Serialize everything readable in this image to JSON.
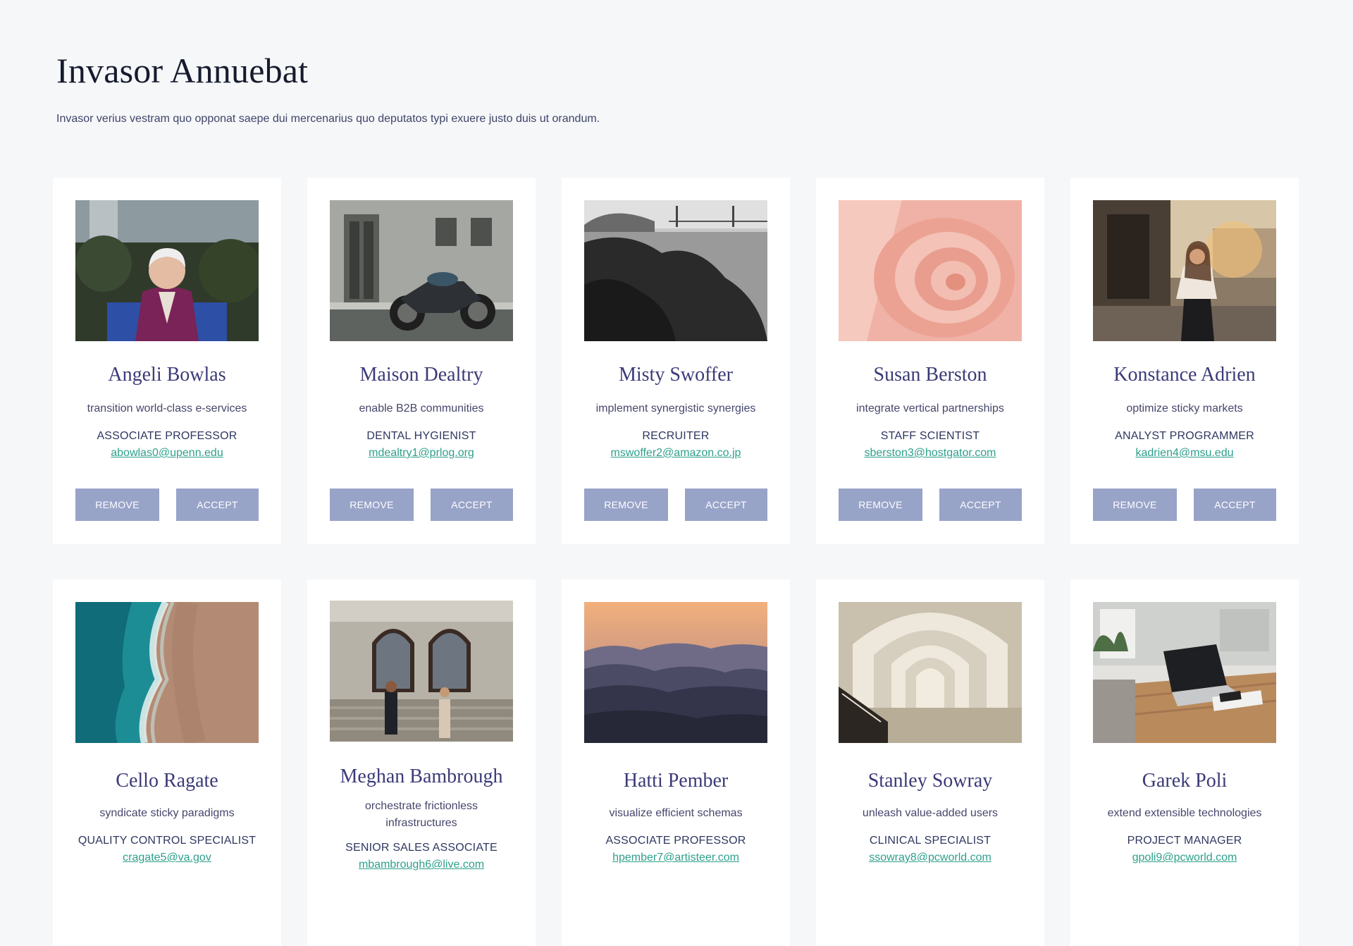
{
  "header": {
    "title": "Invasor Annuebat",
    "subtitle": "Invasor verius vestram quo opponat saepe dui mercenarius quo deputatos typi exuere justo duis ut orandum."
  },
  "colors": {
    "background": "#f6f7f9",
    "card": "#ffffff",
    "name": "#3b3a78",
    "email_link": "#2ea08b",
    "button": "#98a3c8"
  },
  "buttons": {
    "remove_label": "REMOVE",
    "accept_label": "ACCEPT"
  },
  "people": [
    {
      "name": "Angeli Bowlas",
      "tagline": "transition world-class e-services",
      "role": "ASSOCIATE PROFESSOR",
      "email": "abowlas0@upenn.edu",
      "image": "older-woman-portrait-photo"
    },
    {
      "name": "Maison Dealtry",
      "tagline": "enable B2B communities",
      "role": "DENTAL HYGIENIST",
      "email": "mdealtry1@prlog.org",
      "image": "motorcycle-street-photo"
    },
    {
      "name": "Misty Swoffer",
      "tagline": "implement synergistic synergies",
      "role": "RECRUITER",
      "email": "mswoffer2@amazon.co.jp",
      "image": "bay-bridge-bw-photo"
    },
    {
      "name": "Susan Berston",
      "tagline": "integrate vertical partnerships",
      "role": "STAFF SCIENTIST",
      "email": "sberston3@hostgator.com",
      "image": "pink-spiral-abstract-photo"
    },
    {
      "name": "Konstance Adrien",
      "tagline": "optimize sticky markets",
      "role": "ANALYST PROGRAMMER",
      "email": "kadrien4@msu.edu",
      "image": "woman-sunset-street-photo"
    },
    {
      "name": "Cello Ragate",
      "tagline": "syndicate sticky paradigms",
      "role": "QUALITY CONTROL SPECIALIST",
      "email": "cragate5@va.gov",
      "image": "aerial-beach-waves-photo"
    },
    {
      "name": "Meghan Bambrough",
      "tagline": "orchestrate frictionless infrastructures",
      "role": "SENIOR SALES ASSOCIATE",
      "email": "mbambrough6@live.com",
      "image": "couple-building-steps-photo"
    },
    {
      "name": "Hatti Pember",
      "tagline": "visualize efficient schemas",
      "role": "ASSOCIATE PROFESSOR",
      "email": "hpember7@artisteer.com",
      "image": "mountain-sunset-photo"
    },
    {
      "name": "Stanley Sowray",
      "tagline": "unleash value-added users",
      "role": "CLINICAL SPECIALIST",
      "email": "ssowray8@pcworld.com",
      "image": "arched-corridor-photo"
    },
    {
      "name": "Garek Poli",
      "tagline": "extend extensible technologies",
      "role": "PROJECT MANAGER",
      "email": "gpoli9@pcworld.com",
      "image": "laptop-desk-photo"
    }
  ]
}
